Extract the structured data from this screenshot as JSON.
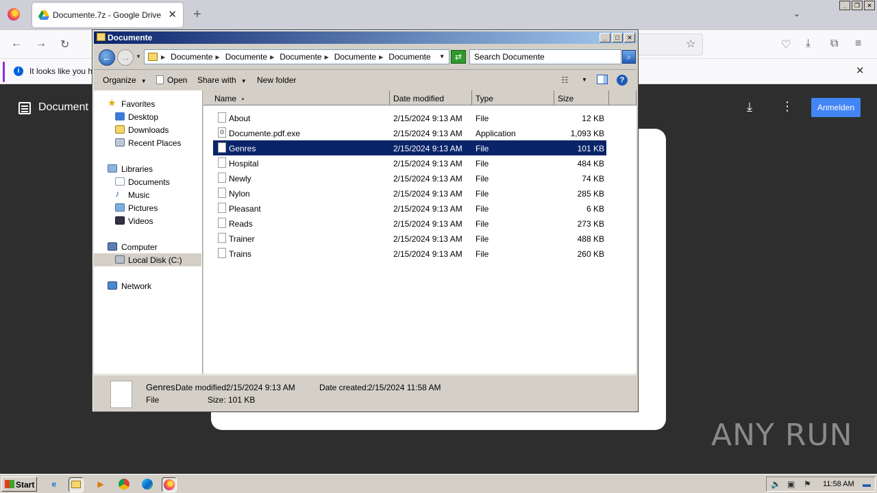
{
  "browser": {
    "tab_title": "Documente.7z - Google Drive",
    "notice_text": "It looks like you ha"
  },
  "drive": {
    "title": "Document",
    "signin_label": "Anmelden"
  },
  "watermark": "ANY RUN",
  "explorer": {
    "window_title": "Documente",
    "breadcrumbs": [
      "Documente",
      "Documente",
      "Documente",
      "Documente",
      "Documente"
    ],
    "search_placeholder": "Search Documente",
    "toolbar": {
      "organize": "Organize",
      "open": "Open",
      "share_with": "Share with",
      "new_folder": "New folder"
    },
    "nav": {
      "favorites": "Favorites",
      "desktop": "Desktop",
      "downloads": "Downloads",
      "recent_places": "Recent Places",
      "libraries": "Libraries",
      "documents": "Documents",
      "music": "Music",
      "pictures": "Pictures",
      "videos": "Videos",
      "computer": "Computer",
      "local_disk": "Local Disk (C:)",
      "network": "Network"
    },
    "columns": {
      "name": "Name",
      "date_modified": "Date modified",
      "type": "Type",
      "size": "Size"
    },
    "files": [
      {
        "name": "About",
        "date": "2/15/2024 9:13 AM",
        "type": "File",
        "size": "12 KB"
      },
      {
        "name": "Documente.pdf.exe",
        "date": "2/15/2024 9:13 AM",
        "type": "Application",
        "size": "1,093 KB"
      },
      {
        "name": "Genres",
        "date": "2/15/2024 9:13 AM",
        "type": "File",
        "size": "101 KB"
      },
      {
        "name": "Hospital",
        "date": "2/15/2024 9:13 AM",
        "type": "File",
        "size": "484 KB"
      },
      {
        "name": "Newly",
        "date": "2/15/2024 9:13 AM",
        "type": "File",
        "size": "74 KB"
      },
      {
        "name": "Nylon",
        "date": "2/15/2024 9:13 AM",
        "type": "File",
        "size": "285 KB"
      },
      {
        "name": "Pleasant",
        "date": "2/15/2024 9:13 AM",
        "type": "File",
        "size": "6 KB"
      },
      {
        "name": "Reads",
        "date": "2/15/2024 9:13 AM",
        "type": "File",
        "size": "273 KB"
      },
      {
        "name": "Trainer",
        "date": "2/15/2024 9:13 AM",
        "type": "File",
        "size": "488 KB"
      },
      {
        "name": "Trains",
        "date": "2/15/2024 9:13 AM",
        "type": "File",
        "size": "260 KB"
      }
    ],
    "selected_file": "Genres",
    "details": {
      "name": "Genres",
      "date_modified_label": "Date modified:",
      "date_modified": "2/15/2024 9:13 AM",
      "date_created_label": "Date created:",
      "date_created": "2/15/2024 11:58 AM",
      "type": "File",
      "size_label": "Size:",
      "size": "101 KB"
    }
  },
  "taskbar": {
    "start_label": "Start",
    "clock": "11:58 AM"
  },
  "colors": {
    "selection": "#0a246a",
    "drive_button": "#4285f4",
    "titlebar": "#0a246a"
  }
}
